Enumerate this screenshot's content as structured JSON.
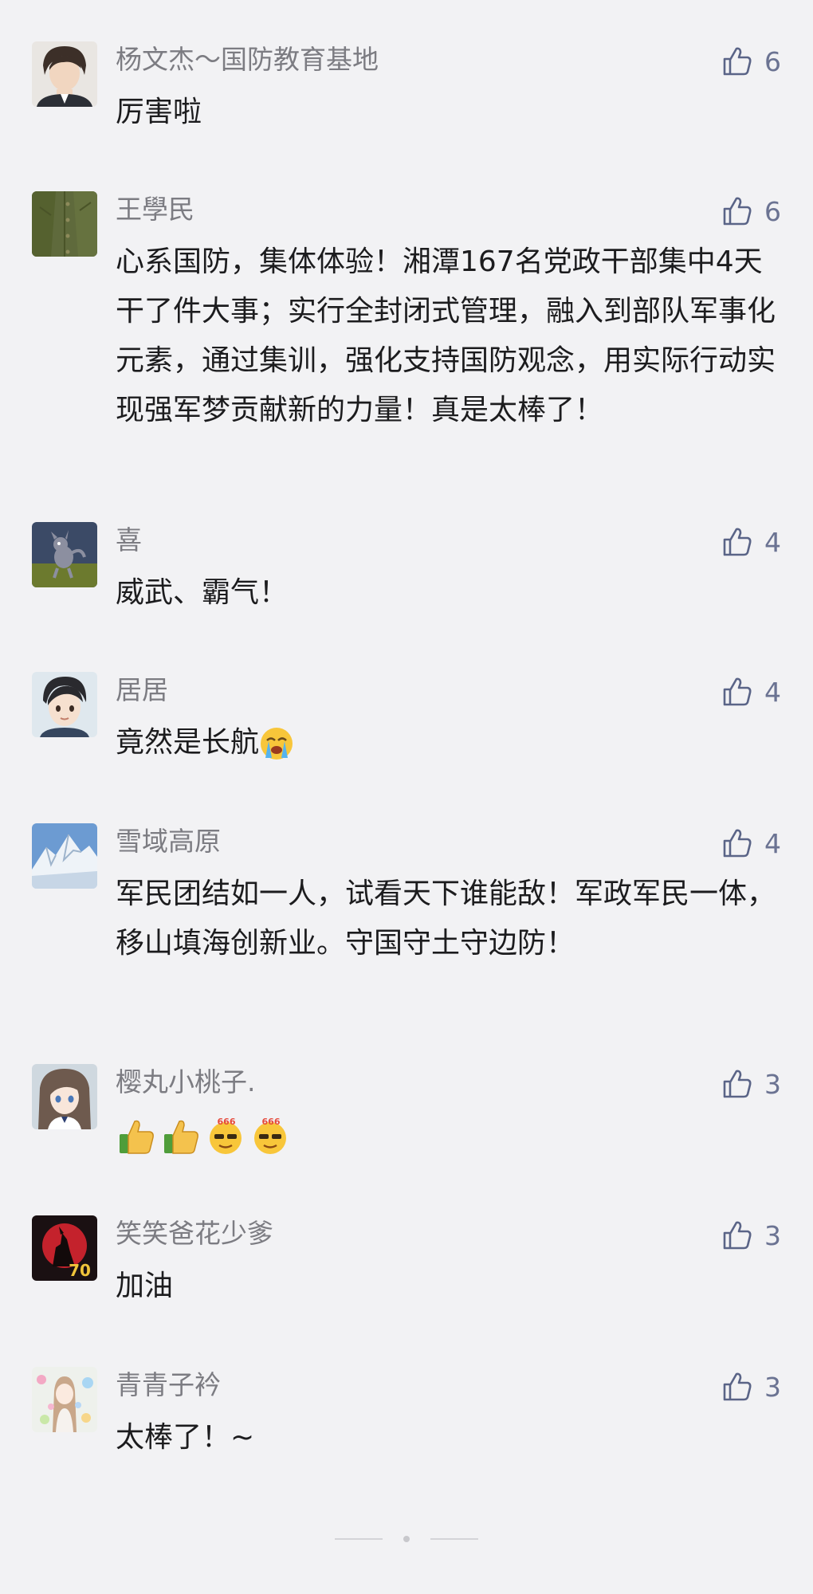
{
  "comments": [
    {
      "username": "杨文杰～国防教育基地",
      "text": "厉害啦",
      "likes": "6",
      "avatar": "avatar-young-man"
    },
    {
      "username": "王學民",
      "text": "心系国防，集体体验！湘潭167名党政干部集中4天干了件大事；实行全封闭式管理，融入到部队军事化元素，通过集训，强化支持国防观念，用实际行动实现强军梦贡献新的力量！真是太棒了！",
      "likes": "6",
      "avatar": "avatar-green-shirt"
    },
    {
      "username": "喜",
      "text": "威武、霸气！",
      "likes": "4",
      "avatar": "avatar-cartoon-cat"
    },
    {
      "username": "居居",
      "text": "竟然是长航",
      "likes": "4",
      "avatar": "avatar-anime-boy",
      "emojis": [
        "crying-emoji"
      ]
    },
    {
      "username": "雪域高原",
      "text": "军民团结如一人，试看天下谁能敌！军政军民一体，移山填海创新业。守国守土守边防！",
      "likes": "4",
      "avatar": "avatar-snow-mountain"
    },
    {
      "username": "樱丸小桃子.",
      "text": "",
      "likes": "3",
      "avatar": "avatar-anime-girl",
      "emojis": [
        "thumbs-up-emoji",
        "thumbs-up-emoji",
        "666-emoji",
        "666-emoji"
      ]
    },
    {
      "username": "笑笑爸花少爹",
      "text": "加油",
      "likes": "3",
      "avatar": "avatar-red-moon-wolf",
      "avatar_text": "70"
    },
    {
      "username": "青青子衿",
      "text": "太棒了！~",
      "likes": "3",
      "avatar": "avatar-flower-girl"
    }
  ],
  "colors": {
    "background": "#f2f2f4",
    "username": "#7c7c82",
    "text": "#1c1c1e",
    "like_icon": "#5a6487",
    "like_count": "#6b7392"
  }
}
